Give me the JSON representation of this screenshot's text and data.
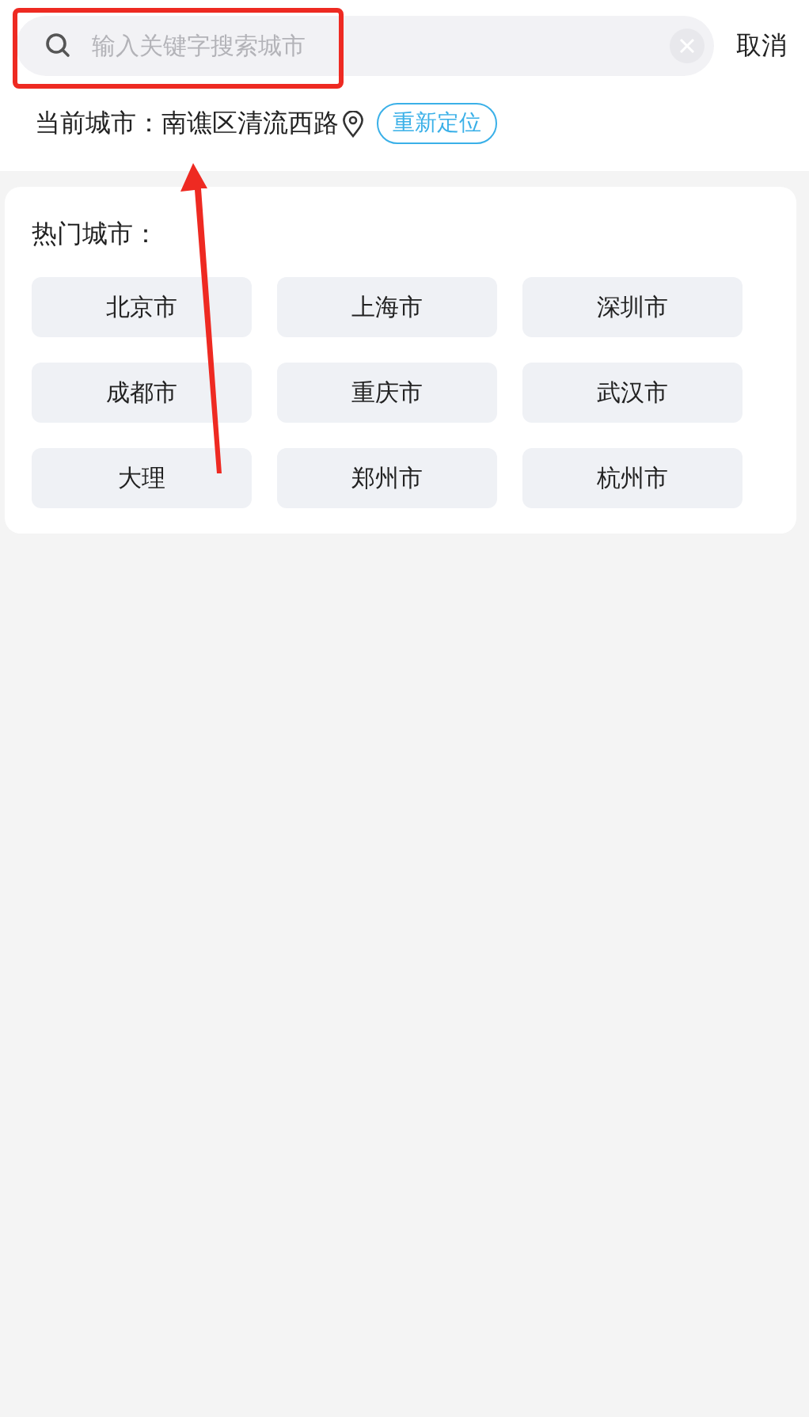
{
  "search": {
    "placeholder": "输入关键字搜索城市"
  },
  "cancel": "取消",
  "current": {
    "label": "当前城市：",
    "address": "南谯区清流西路",
    "relocate": "重新定位"
  },
  "hot": {
    "title": "热门城市：",
    "cities": [
      "北京市",
      "上海市",
      "深圳市",
      "成都市",
      "重庆市",
      "武汉市",
      "大理",
      "郑州市",
      "杭州市"
    ]
  },
  "annotation": {
    "kind": "box-arrow"
  }
}
